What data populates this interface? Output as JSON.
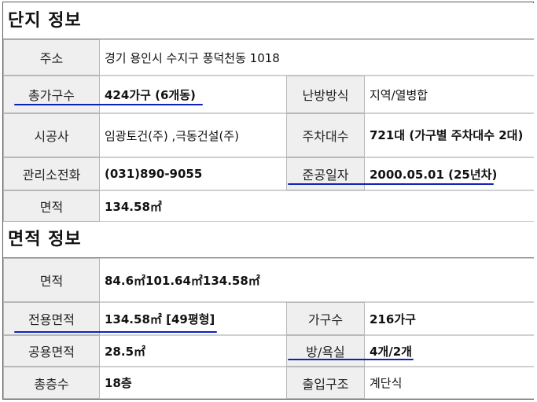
{
  "complex_section": {
    "title": "단지 정보",
    "rows": [
      {
        "label": "주소",
        "value": "경기 용인시 수지구 풍덕천동 1018"
      },
      {
        "label": "총가구수",
        "value": "424가구 (6개동)",
        "label2": "난방방식",
        "value2": "지역/열병합"
      },
      {
        "label": "시공사",
        "value": "임광토건(주) ,극동건설(주)",
        "label2": "주차대수",
        "value2": "721대 (가구별 주차대수 2대)"
      },
      {
        "label": "관리소전화",
        "value": "(031)890-9055",
        "label2": "준공일자",
        "value2": "2000.05.01 (25년차)"
      },
      {
        "label": "면적",
        "value": "134.58㎡"
      }
    ]
  },
  "area_section": {
    "title": "면적 정보",
    "rows": [
      {
        "label": "면적",
        "value": "84.6㎡101.64㎡134.58㎡"
      },
      {
        "label": "전용면적",
        "value": "134.58㎡ [49평형]",
        "label2": "가구수",
        "value2": "216가구"
      },
      {
        "label": "공용면적",
        "value": "28.5㎡",
        "label2": "방/욕실",
        "value2": "4개/2개"
      },
      {
        "label": "총층수",
        "value": "18층",
        "label2": "출입구조",
        "value2": "계단식"
      }
    ]
  },
  "annotation_color": "#0f22b8"
}
